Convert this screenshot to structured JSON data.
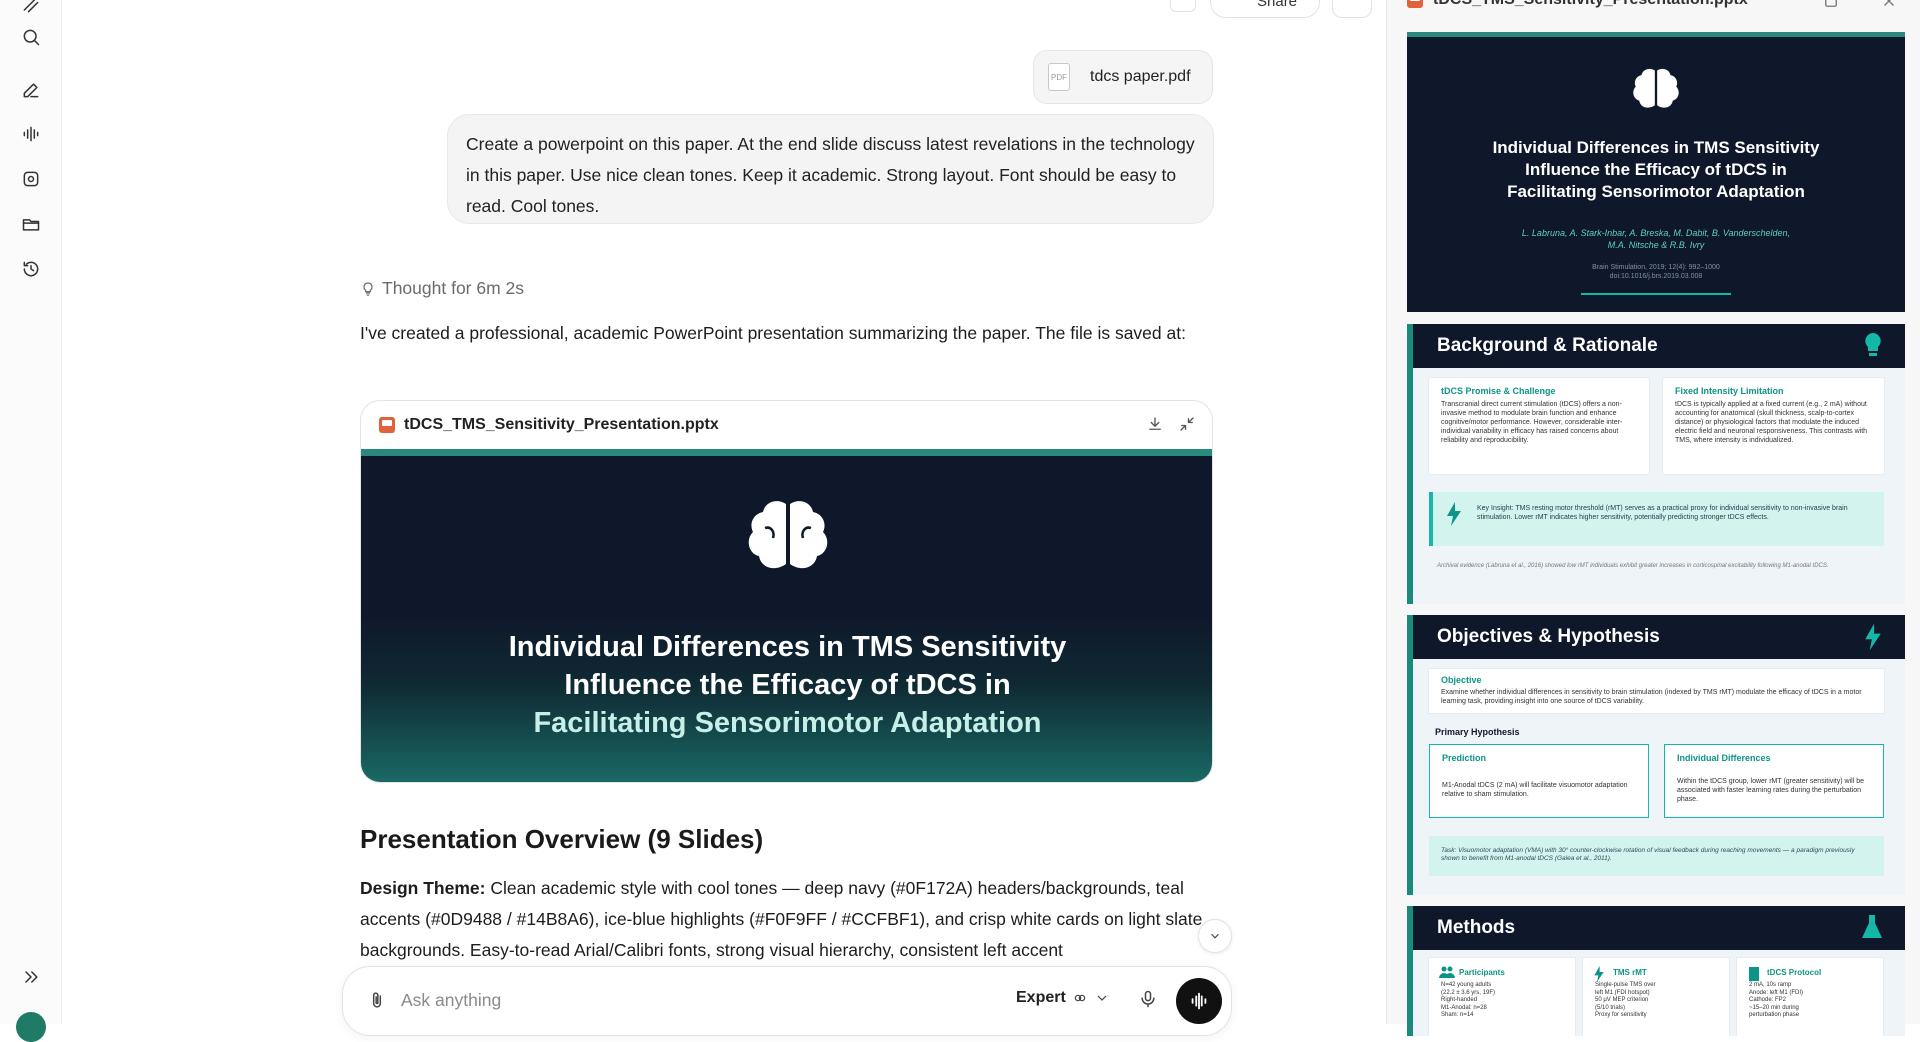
{
  "colors": {
    "navy": "#0F172A",
    "teal": "#0D9488",
    "teal_light": "#14B8A6",
    "ice": "#F0F9FF",
    "mint": "#CCFBF1"
  },
  "top_bar": {
    "share_label": "Share"
  },
  "sidebar": {
    "items": [
      {
        "icon": "search-icon"
      },
      {
        "icon": "edit-icon"
      },
      {
        "icon": "voice-icon"
      },
      {
        "icon": "imagine-icon"
      },
      {
        "icon": "projects-icon"
      },
      {
        "icon": "history-icon"
      }
    ],
    "expand_icon": "chevrons-right-icon"
  },
  "chat": {
    "attachment": {
      "name": "tdcs paper.pdf",
      "type_label": "PDF"
    },
    "user_message": "Create a powerpoint on this paper. At the end slide discuss latest revelations in the technology in this paper. Use nice clean tones. Keep it academic. Strong layout. Font should be easy to read. Cool tones.",
    "thought_label": "Thought for 6m 2s",
    "reply_intro": "I've created a professional, academic PowerPoint presentation summarizing the paper. The file is saved at:",
    "artifact": {
      "filename": "tDCS_TMS_Sensitivity_Presentation.pptx",
      "slide_title_l1": "Individual Differences in TMS Sensitivity",
      "slide_title_l2": "Influence the Efficacy of tDCS in",
      "slide_title_l3": "Facilitating Sensorimotor Adaptation"
    },
    "overview_heading": "Presentation Overview (9 Slides)",
    "design_label": "Design Theme:",
    "design_text": " Clean academic style with cool tones — deep navy (#0F172A) headers/backgrounds, teal accents (#0D9488 / #14B8A6), ice-blue highlights (#F0F9FF / #CCFBF1), and crisp white cards on light slate backgrounds. Easy-to-read Arial/Calibri fonts, strong visual hierarchy, consistent left accent"
  },
  "composer": {
    "placeholder": "Ask anything",
    "mode_label": "Expert"
  },
  "preview": {
    "filename": "tDCS_TMS_Sensitivity_Presentation.pptx",
    "slide1": {
      "title_l1": "Individual Differences in TMS Sensitivity",
      "title_l2": "Influence the Efficacy of tDCS in",
      "title_l3": "Facilitating Sensorimotor Adaptation",
      "authors_l1": "L. Labruna, A. Stark-Inbar, A. Breska, M. Dabit, B. Vanderschelden,",
      "authors_l2": "M.A. Nitsche & R.B. Ivry",
      "cite_l1": "Brain Stimulation, 2019; 12(4): 992–1000",
      "cite_l2": "doi:10.1016/j.brs.2019.03.008"
    },
    "slide2": {
      "heading": "Background & Rationale",
      "card1_title": "tDCS Promise & Challenge",
      "card1_body": "Transcranial direct current stimulation (tDCS) offers a non-invasive method to modulate brain function and enhance cognitive/motor performance. However, considerable inter-individual variability in efficacy has raised concerns about reliability and reproducibility.",
      "card2_title": "Fixed Intensity Limitation",
      "card2_body": "tDCS is typically applied at a fixed current (e.g., 2 mA) without accounting for anatomical (skull thickness, scalp-to-cortex distance) or physiological factors that modulate the induced electric field and neuronal responsiveness. This contrasts with TMS, where intensity is individualized.",
      "insight": "Key Insight: TMS resting motor threshold (rMT) serves as a practical proxy for individual sensitivity to non-invasive brain stimulation. Lower rMT indicates higher sensitivity, potentially predicting stronger tDCS effects.",
      "footnote": "Archival evidence (Labruna et al., 2016) showed low rMT individuals exhibit greater increases in corticospinal excitability following M1-anodal tDCS."
    },
    "slide3": {
      "heading": "Objectives & Hypothesis",
      "objective_title": "Objective",
      "objective_body": "Examine whether individual differences in sensitivity to brain stimulation (indexed by TMS rMT) modulate the efficacy of tDCS in a motor learning task, providing insight into one source of tDCS variability.",
      "hyp_label": "Primary Hypothesis",
      "pred_title": "Prediction",
      "pred_body": "M1-Anodal tDCS (2 mA) will facilitate visuomotor adaptation relative to sham stimulation.",
      "ind_title": "Individual Differences",
      "ind_body": "Within the tDCS group, lower rMT (greater sensitivity) will be associated with faster learning rates during the perturbation phase.",
      "task": "Task: Visuomotor adaptation (VMA) with 30° counter-clockwise rotation of visual feedback during reaching movements — a paradigm previously shown to benefit from M1-anodal tDCS (Galea et al., 2011)."
    },
    "slide4": {
      "heading": "Methods",
      "c1_title": "Participants",
      "c1_body": "N=42 young adults\n(22.2 ± 3.6 yrs, 19F)\nRight-handed\nM1-Anodal: n=28\nSham: n=14",
      "c2_title": "TMS rMT",
      "c2_body": "Single-pulse TMS over\nleft M1 (FDI hotspot)\n50 μV MEP criterion\n(5/10 trials)\nProxy for sensitivity",
      "c3_title": "tDCS Protocol",
      "c3_body": "2 mA, 10s ramp\nAnode: left M1 (FDI)\nCathode: FP2\n~15–20 min during\nperturbation phase"
    }
  }
}
